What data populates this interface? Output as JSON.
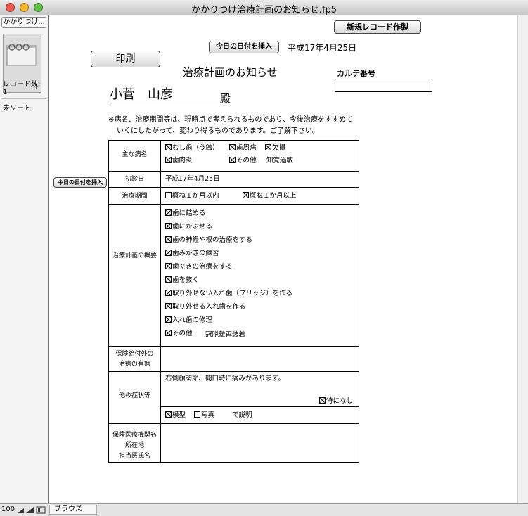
{
  "window": {
    "title": "かかりつけ治療計画のお知らせ.fp5"
  },
  "status_area": {
    "layout_button": "かかりつけ...",
    "record_index": "1",
    "records_label": "レコード数:",
    "records_count": "1",
    "sort_status": "未ソート"
  },
  "status_bar": {
    "zoom": "100",
    "mode": "ブラウズ"
  },
  "header": {
    "new_record_button": "新規レコード作製",
    "insert_date_button": "今日の日付を挿入",
    "current_date": "平成17年4月25日",
    "print_button": "印刷",
    "form_title": "治療計画のお知らせ",
    "chart_number_label": "カルテ番号",
    "chart_number_value": "",
    "patient_name": "小菅　山彦",
    "honorific": "殿",
    "notice_line1": "※病名、治療期間等は、現時点で考えられるものであり、今後治療をすすめて",
    "notice_line2": "いくにしたがって、変わり得るものであります。ご了解下さい。"
  },
  "form": {
    "insert_date_side_button": "今日の日付を挿入",
    "diagnosis": {
      "label": "主な病名",
      "options": [
        {
          "label": "むし歯（う蝕）",
          "checked": true
        },
        {
          "label": "歯周病",
          "checked": true
        },
        {
          "label": "欠損",
          "checked": true
        },
        {
          "label": "歯肉炎",
          "checked": true
        },
        {
          "label": "その他",
          "checked": true
        }
      ],
      "other_text": "知覚過敏"
    },
    "first_visit": {
      "label": "初診日",
      "value": "平成17年4月25日"
    },
    "treatment_period": {
      "label": "治療期間",
      "options": [
        {
          "label": "概ね１か月以内",
          "checked": false
        },
        {
          "label": "概ね１か月以上",
          "checked": true
        }
      ]
    },
    "plan_overview": {
      "label": "治療計画の概要",
      "items": [
        {
          "label": "歯に詰める",
          "checked": true
        },
        {
          "label": "歯にかぶせる",
          "checked": true
        },
        {
          "label": "歯の神経や根の治療をする",
          "checked": true
        },
        {
          "label": "歯みがきの練習",
          "checked": true
        },
        {
          "label": "歯ぐきの治療をする",
          "checked": true
        },
        {
          "label": "歯を抜く",
          "checked": true
        },
        {
          "label": "取り外せない入れ歯（ブリッジ）を作る",
          "checked": true
        },
        {
          "label": "取り外せる入れ歯を作る",
          "checked": true
        },
        {
          "label": "入れ歯の修理",
          "checked": true
        },
        {
          "label": "その他",
          "checked": true
        }
      ],
      "other_text": "冠脱離再装着"
    },
    "non_insured": {
      "label_line1": "保険給付外の",
      "label_line2": "治療の有無",
      "value": ""
    },
    "other_symptoms": {
      "label": "他の症状等",
      "value": "右側顎関節、開口時に痛みがあります。",
      "none_label": "特になし",
      "none_checked": true
    },
    "explanation": {
      "options": [
        {
          "label": "模型",
          "checked": true
        },
        {
          "label": "写真",
          "checked": false
        }
      ],
      "suffix": "で説明"
    },
    "institution": {
      "label_line1": "保険医療機関名",
      "label_line2": "所在地",
      "label_line3": "担当医氏名",
      "value": ""
    }
  },
  "colors": {
    "close": "#ee5b4f",
    "minimize": "#f5b630",
    "zoom": "#5fbf45"
  }
}
